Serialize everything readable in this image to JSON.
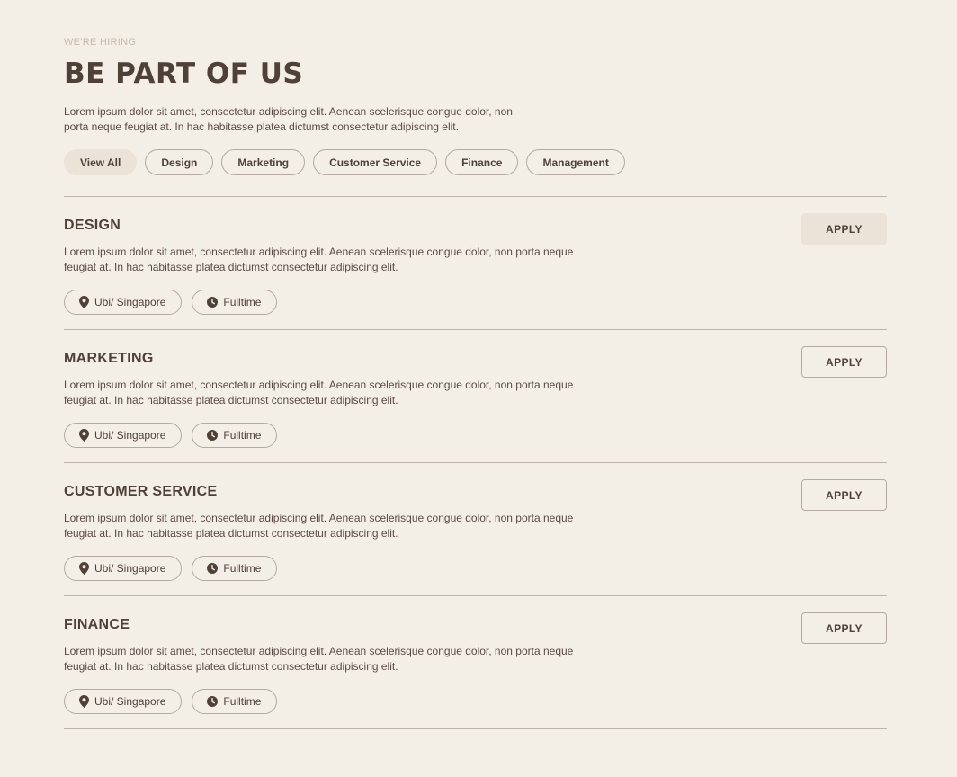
{
  "header": {
    "eyebrow": "WE'RE HIRING",
    "title": "BE PART OF US",
    "intro": "Lorem ipsum dolor sit amet, consectetur adipiscing elit. Aenean scelerisque congue dolor, non porta neque feugiat at. In hac habitasse platea dictumst consectetur adipiscing elit."
  },
  "filters": [
    {
      "label": "View All",
      "active": true
    },
    {
      "label": "Design",
      "active": false
    },
    {
      "label": "Marketing",
      "active": false
    },
    {
      "label": "Customer Service",
      "active": false
    },
    {
      "label": "Finance",
      "active": false
    },
    {
      "label": "Management",
      "active": false
    }
  ],
  "jobs": [
    {
      "title": "DESIGN",
      "description": "Lorem ipsum dolor sit amet, consectetur adipiscing elit. Aenean scelerisque congue dolor, non porta neque feugiat at. In hac habitasse platea dictumst consectetur adipiscing elit.",
      "location": "Ubi/ Singapore",
      "type": "Fulltime",
      "apply_label": "APPLY",
      "apply_highlighted": true
    },
    {
      "title": "MARKETING",
      "description": "Lorem ipsum dolor sit amet, consectetur adipiscing elit. Aenean scelerisque congue dolor, non porta neque feugiat at. In hac habitasse platea dictumst consectetur adipiscing elit.",
      "location": "Ubi/ Singapore",
      "type": "Fulltime",
      "apply_label": "APPLY",
      "apply_highlighted": false
    },
    {
      "title": "CUSTOMER SERVICE",
      "description": "Lorem ipsum dolor sit amet, consectetur adipiscing elit. Aenean scelerisque congue dolor, non porta neque feugiat at. In hac habitasse platea dictumst consectetur adipiscing elit.",
      "location": "Ubi/ Singapore",
      "type": "Fulltime",
      "apply_label": "APPLY",
      "apply_highlighted": false
    },
    {
      "title": "FINANCE",
      "description": "Lorem ipsum dolor sit amet, consectetur adipiscing elit. Aenean scelerisque congue dolor, non porta neque feugiat at. In hac habitasse platea dictumst consectetur adipiscing elit.",
      "location": "Ubi/ Singapore",
      "type": "Fulltime",
      "apply_label": "APPLY",
      "apply_highlighted": false
    }
  ],
  "icons": {
    "location": "location-pin-icon",
    "type": "clock-icon"
  },
  "colors": {
    "background": "#f3eee6",
    "text": "#4f4038",
    "eyebrow": "#c8b9aa",
    "active_fill": "#ebe2d8",
    "border": "#b5aaa2"
  }
}
